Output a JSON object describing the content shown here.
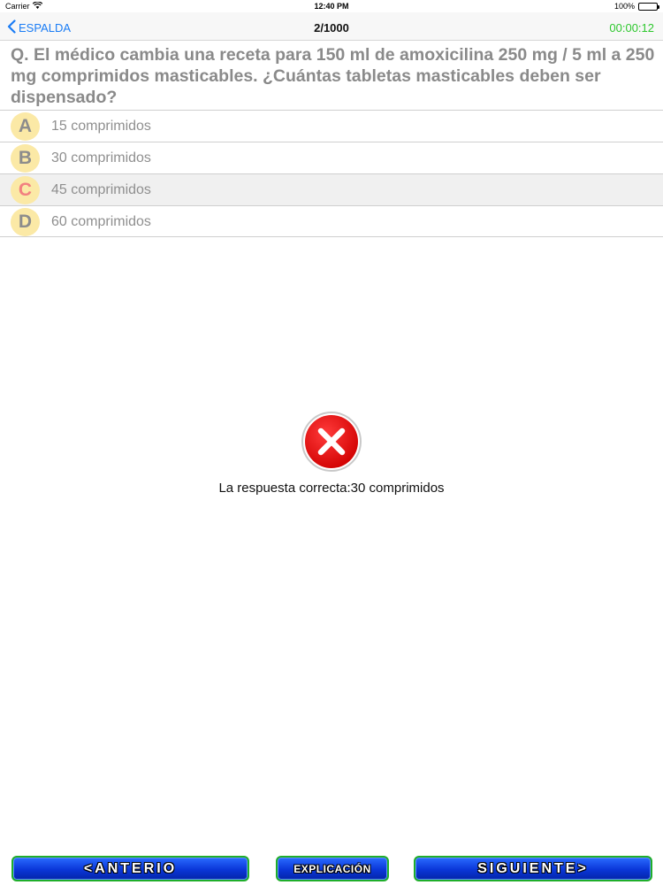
{
  "status_bar": {
    "carrier": "Carrier",
    "time": "12:40 PM",
    "battery": "100%",
    "wifi_icon": "wifi-icon",
    "battery_icon": "battery-icon"
  },
  "nav": {
    "back_label": "ESPALDA",
    "back_icon": "chevron-left-icon",
    "title": "2/1000",
    "timer": "00:00:12",
    "accent_color": "#1a7cf5",
    "timer_color": "#2ec82e"
  },
  "question": {
    "text": "Q. El médico cambia una receta para 150 ml de amoxicilina 250 mg / 5 ml a 250 mg comprimidos masticables. ¿Cuántas tabletas masticables deben ser dispensado?"
  },
  "options": [
    {
      "letter": "A",
      "text": "15 comprimidos",
      "selected": false
    },
    {
      "letter": "B",
      "text": "30 comprimidos",
      "selected": false
    },
    {
      "letter": "C",
      "text": "45 comprimidos",
      "selected": true
    },
    {
      "letter": "D",
      "text": "60 comprimidos",
      "selected": false
    }
  ],
  "result": {
    "icon": "wrong-x-icon",
    "status": "incorrect",
    "text": "La respuesta correcta:30 comprimidos"
  },
  "buttons": {
    "previous": "<ANTERIO",
    "explanation": "EXPLICACIÓN",
    "next": "SIGUIENTE>"
  }
}
